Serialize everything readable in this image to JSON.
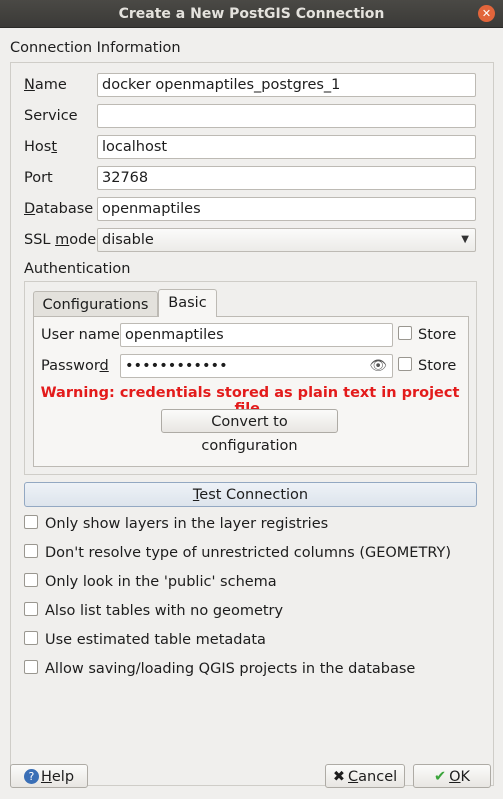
{
  "window": {
    "title": "Create a New PostGIS Connection",
    "close_symbol": "✕"
  },
  "connection": {
    "section_title": "Connection Information",
    "name": {
      "label_pre": "",
      "label_u": "N",
      "label_post": "ame",
      "value": "docker openmaptiles_postgres_1"
    },
    "service": {
      "label": "Service",
      "value": ""
    },
    "host": {
      "label_pre": "Hos",
      "label_u": "t",
      "label_post": "",
      "value": "localhost"
    },
    "port": {
      "label": "Port",
      "value": "32768"
    },
    "database": {
      "label_pre": "",
      "label_u": "D",
      "label_post": "atabase",
      "value": "openmaptiles"
    },
    "ssl_mode": {
      "label_pre": "SSL ",
      "label_u": "m",
      "label_post": "ode",
      "value": "disable"
    }
  },
  "auth": {
    "title": "Authentication",
    "tabs": {
      "configurations": "Configurations",
      "basic": "Basic"
    },
    "username": {
      "label": "User name",
      "value": "openmaptiles",
      "store_label": "Store"
    },
    "password": {
      "label_pre": "Passwor",
      "label_u": "d",
      "label_post": "",
      "value": "••••••••••••",
      "store_label": "Store"
    },
    "warning": "Warning: credentials stored as plain text in project file.",
    "convert_button": "Convert to configuration"
  },
  "test_connection": {
    "label_pre": "",
    "label_u": "T",
    "label_post": "est Connection"
  },
  "options": [
    "Only show layers in the layer registries",
    "Don't resolve type of unrestricted columns (GEOMETRY)",
    "Only look in the 'public' schema",
    "Also list tables with no geometry",
    "Use estimated table metadata",
    "Allow saving/loading QGIS projects in the database"
  ],
  "buttons": {
    "help": {
      "label_pre": "",
      "label_u": "H",
      "label_post": "elp",
      "icon": "?"
    },
    "cancel": {
      "label_pre": "",
      "label_u": "C",
      "label_post": "ancel",
      "icon": "✖"
    },
    "ok": {
      "label_pre": "",
      "label_u": "O",
      "label_post": "K",
      "icon": "✔"
    }
  }
}
